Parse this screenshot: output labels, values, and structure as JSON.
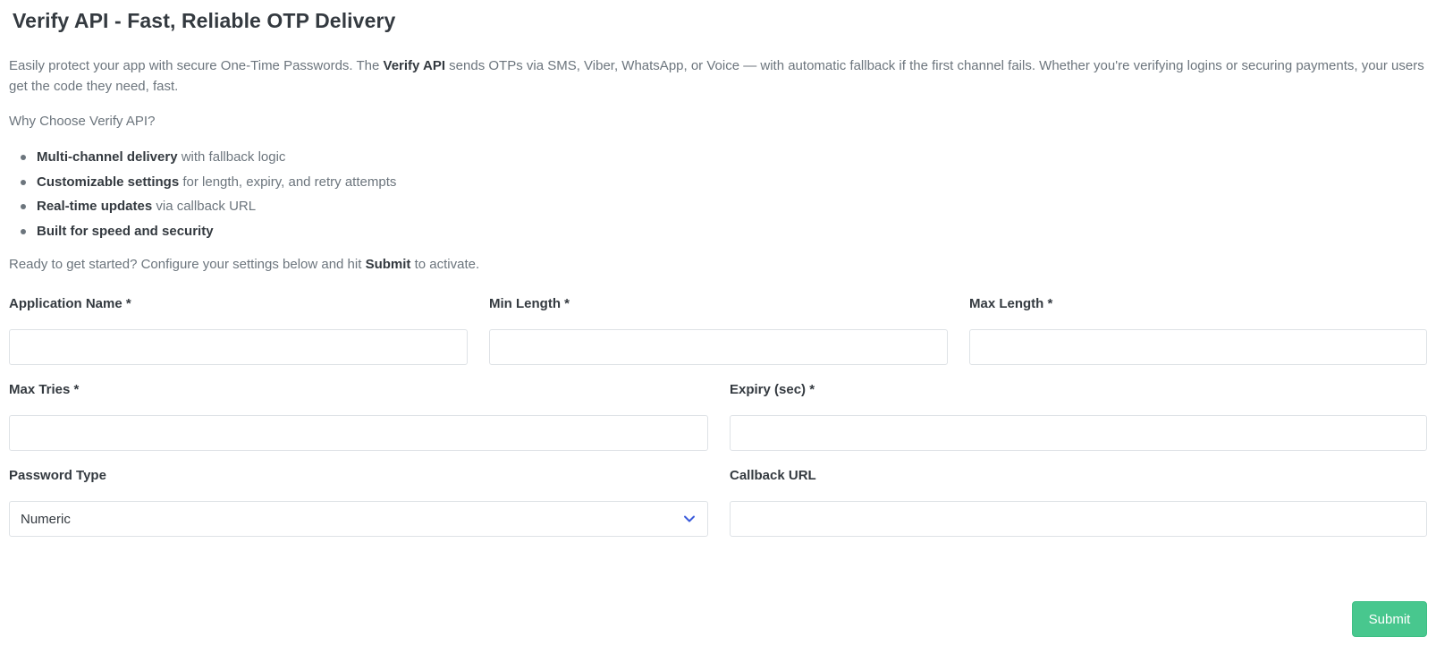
{
  "page": {
    "title": "Verify API - Fast, Reliable OTP Delivery",
    "intro": {
      "part1": "Easily protect your app with secure One-Time Passwords. The ",
      "bold": "Verify API",
      "part2": " sends OTPs via SMS, Viber, WhatsApp, or Voice — with automatic fallback if the first channel fails. Whether you're verifying logins or securing payments, your users get the code they need, fast."
    },
    "why_heading": "Why Choose Verify API?",
    "features": [
      {
        "bold": "Multi-channel delivery",
        "rest": " with fallback logic"
      },
      {
        "bold": "Customizable settings",
        "rest": " for length, expiry, and retry attempts"
      },
      {
        "bold": "Real-time updates",
        "rest": " via callback URL"
      },
      {
        "bold": "Built for speed and security",
        "rest": ""
      }
    ],
    "ready": {
      "part1": "Ready to get started? Configure your settings below and hit ",
      "bold": "Submit",
      "part2": " to activate."
    }
  },
  "form": {
    "app_name": {
      "label": "Application Name *",
      "value": ""
    },
    "min_length": {
      "label": "Min Length *",
      "value": ""
    },
    "max_length": {
      "label": "Max Length *",
      "value": ""
    },
    "max_tries": {
      "label": "Max Tries *",
      "value": ""
    },
    "expiry": {
      "label": "Expiry (sec) *",
      "value": ""
    },
    "password_type": {
      "label": "Password Type",
      "selected": "Numeric",
      "icon": "chevron-down-icon"
    },
    "callback_url": {
      "label": "Callback URL",
      "value": ""
    },
    "submit_label": "Submit"
  },
  "colors": {
    "submit_bg": "#48c78e",
    "heading_text": "#343a40",
    "body_text": "#6c757d",
    "field_border": "#dee2e6",
    "chevron": "#3b5bdb"
  }
}
